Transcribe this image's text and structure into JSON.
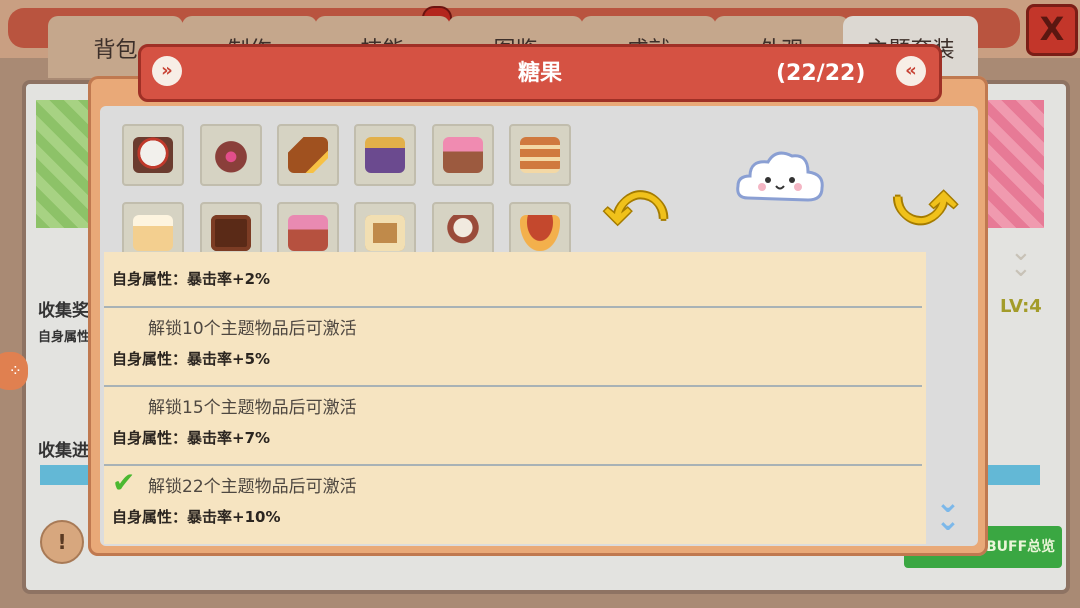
{
  "background": {
    "tabs": [
      {
        "label": "背包"
      },
      {
        "label": "制作"
      },
      {
        "label": "技能"
      },
      {
        "label": "图鉴"
      },
      {
        "label": "成就"
      },
      {
        "label": "外观"
      },
      {
        "label": "主题套装"
      }
    ],
    "close_label": "X",
    "collect_reward_label": "收集奖",
    "self_attr_label": "自身属性",
    "collect_progress_label": "收集进",
    "level_label": "LV:4",
    "buff_overview_label": "BUFF总览",
    "info_button_label": "!"
  },
  "modal": {
    "title": "糖果",
    "count": "(22/22)",
    "prev_arrow": "«",
    "next_arrow": "»"
  },
  "items": [
    {
      "name": "cake-item-icon",
      "color": "#f2f0ec",
      "accent": "#c0392b"
    },
    {
      "name": "donut-item-icon",
      "color": "#8a3f3a",
      "accent": "#e24e8b"
    },
    {
      "name": "chocolate-item-icon",
      "color": "#a0511f",
      "accent": "#f7c144"
    },
    {
      "name": "candy-shop-item-icon",
      "color": "#6b4a8f",
      "accent": "#e2b04a"
    },
    {
      "name": "dessert-stand-item-icon",
      "color": "#9c5a3f",
      "accent": "#f08bb1"
    },
    {
      "name": "cake-tower-item-icon",
      "color": "#d0793e",
      "accent": "#f3d8a5"
    },
    {
      "name": "cream-cake-item-icon",
      "color": "#f3cf8f",
      "accent": "#fdf4df"
    },
    {
      "name": "chocolate-bar-item-icon",
      "color": "#5a2a17",
      "accent": "#7c3c24"
    },
    {
      "name": "candy-cart-item-icon",
      "color": "#b6513f",
      "accent": "#e98ab2"
    },
    {
      "name": "menu-board-item-icon",
      "color": "#c08a4a",
      "accent": "#f2dfb2"
    },
    {
      "name": "ice-cream-stool-item-icon",
      "color": "#9a4b3a",
      "accent": "#f1eadf"
    },
    {
      "name": "mushroom-house-item-icon",
      "color": "#c4482d",
      "accent": "#f3b04c"
    }
  ],
  "attributes": [
    {
      "unlock": "",
      "effect": "自身属性：暴击率+2%"
    },
    {
      "unlock": "解锁10个主题物品后可激活",
      "effect": "自身属性：暴击率+5%"
    },
    {
      "unlock": "解锁15个主题物品后可激活",
      "effect": "自身属性：暴击率+7%"
    },
    {
      "unlock": "解锁22个主题物品后可激活",
      "effect": "自身属性：暴击率+10%",
      "completed": true
    }
  ],
  "icons": {
    "check": "✔",
    "scroll_down": "⌄⌄",
    "left_arrow": "⤺",
    "right_arrow": "⤻"
  },
  "colors": {
    "header_red": "#d55243",
    "panel_beige": "#f6e4c1",
    "arrow_gold": "#f0c11b",
    "check_green": "#4bb830"
  }
}
